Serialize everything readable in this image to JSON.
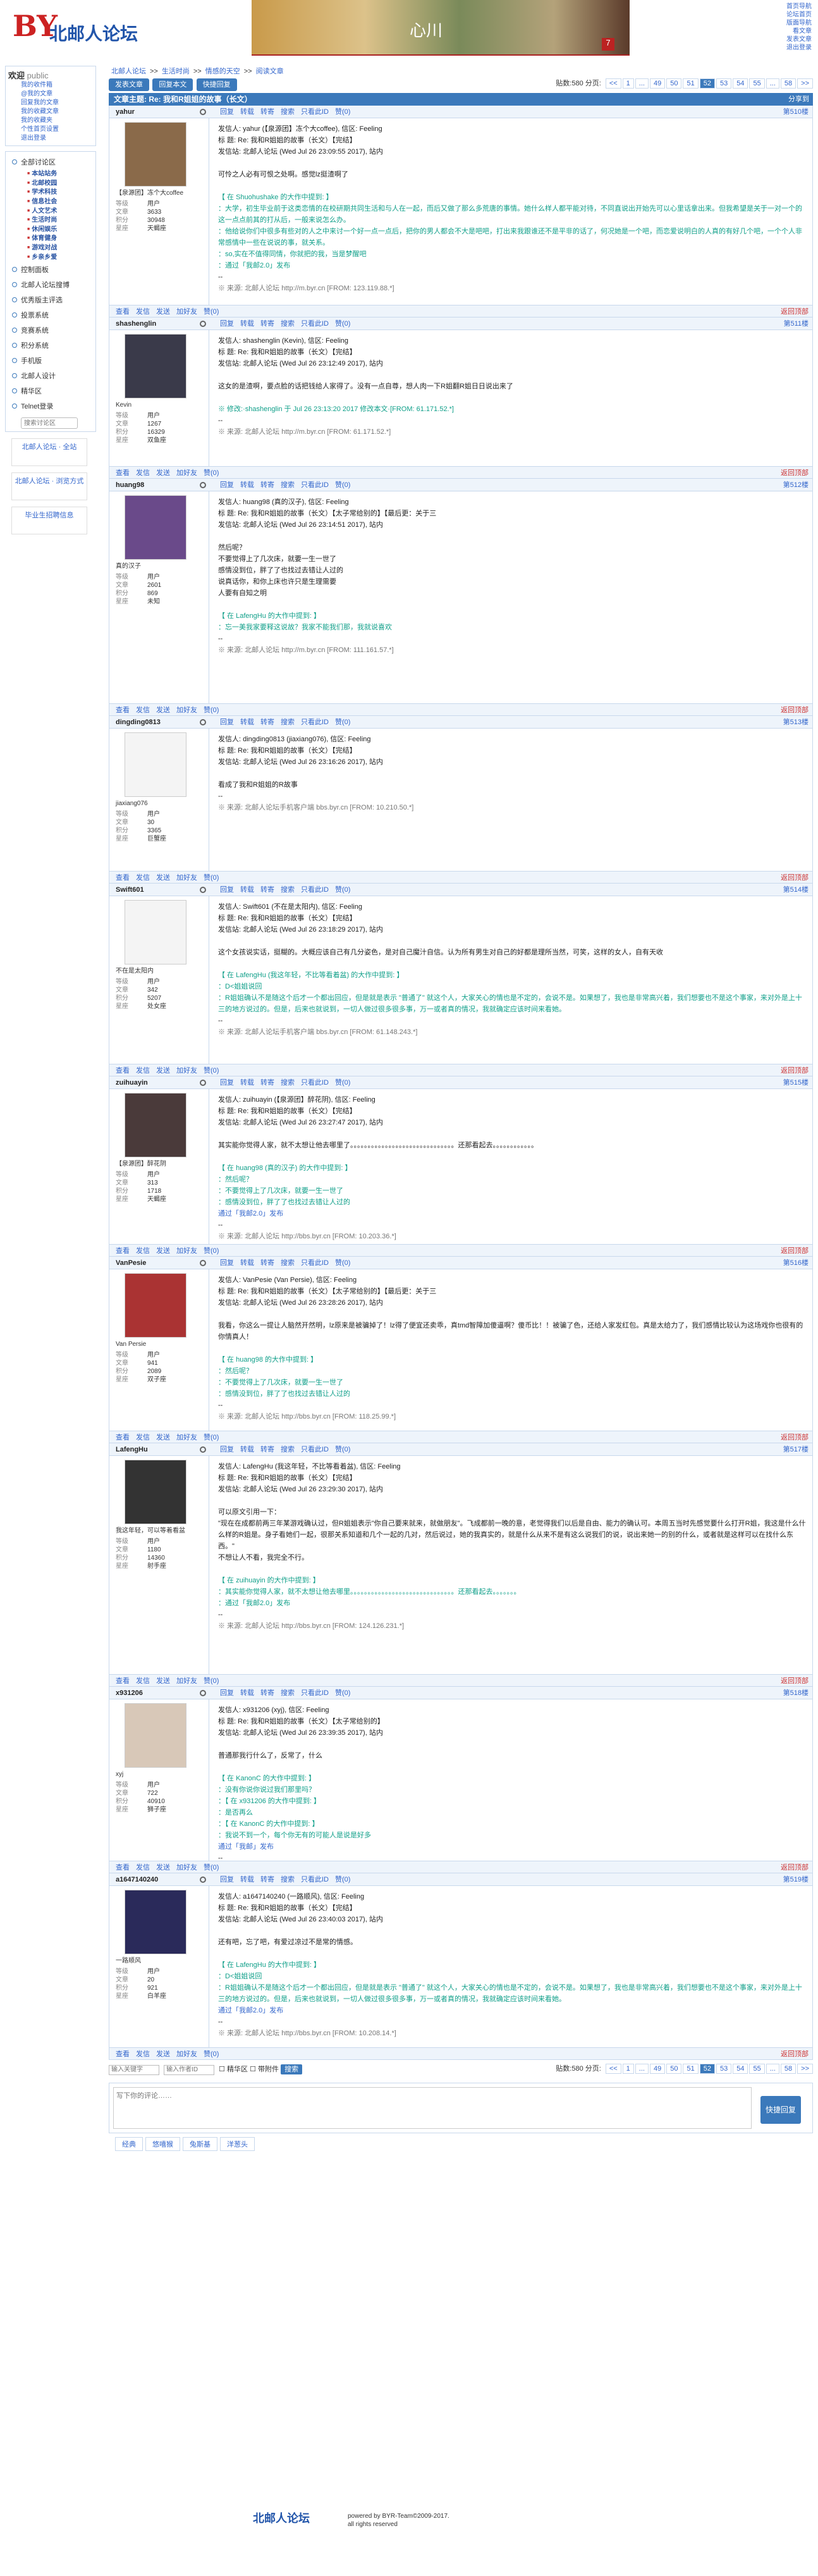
{
  "site": {
    "logo_mark": "BY",
    "logo_name": "北邮人论坛"
  },
  "banner": {
    "text": "心川",
    "badge": "7"
  },
  "toplinks": [
    "首页导航",
    "论坛首页",
    "版面导航",
    "看文章",
    "发表文章",
    "退出登录"
  ],
  "user": {
    "welcome": "欢迎",
    "name": "public",
    "links": [
      "我的收件箱",
      "@我的文章",
      "回复我的文章",
      "我的收藏文章",
      "我的收藏夹",
      "个性首页设置",
      "退出登录"
    ]
  },
  "nav": {
    "items": [
      "全部讨论区"
    ],
    "subs": [
      "本站站务",
      "北邮校园",
      "学术科技",
      "信息社会",
      "人文艺术",
      "生活时尚",
      "休闲娱乐",
      "体育健身",
      "游戏对战",
      "乡亲乡爱"
    ],
    "items2": [
      "控制面板",
      "北邮人论坛搜博",
      "优秀版主评选",
      "投票系统",
      "竞赛系统",
      "积分系统",
      "手机版",
      "北邮人设计",
      "精华区",
      "Telnet登录"
    ],
    "search_placeholder": "搜索讨论区"
  },
  "ads": [
    "北邮人论坛 · 全站",
    "北邮人论坛 · 浏览方式",
    "毕业生招聘信息"
  ],
  "crumb": [
    "北邮人论坛",
    ">>",
    "生活时尚",
    ">>",
    "情感的天空",
    ">>",
    "阅读文章"
  ],
  "toolbar": {
    "new_post": "发表文章",
    "reply": "回复本文",
    "quick_reply": "快捷回复"
  },
  "pager": {
    "total_label": "贴数:580 分页:",
    "pages": [
      "<<",
      "1",
      "...",
      "49",
      "50",
      "51",
      "52",
      "53",
      "54",
      "55",
      "...",
      "58",
      ">>"
    ],
    "current": "52"
  },
  "thread": {
    "title": "文章主题: Re: 我和R姐姐的故事（长文）",
    "share": "分享到"
  },
  "post_actions": [
    "回复",
    "转载",
    "转寄",
    "搜索",
    "只看此ID",
    "赞(0)"
  ],
  "post_foot": [
    "查看",
    "发信",
    "发送",
    "加好友",
    "赞(0)"
  ],
  "back_top": "返回顶部",
  "posts": [
    {
      "id": "yahur",
      "floor": "第510楼",
      "nick": "【泉源团】冻个大coffee",
      "stats": {
        "等级": "用户",
        "文章": "3633",
        "积分": "30948",
        "星座": "天蝎座"
      },
      "header": [
        "发信人: yahur (【泉源团】冻个大coffee), 信区: Feeling",
        "标  题: Re: 我和R姐姐的故事（长文）【完结】",
        "发信站: 北邮人论坛 (Wed Jul 26 23:09:55 2017), 站内"
      ],
      "body": [
        "可怜之人必有可恨之处啊。感觉lz挺渣啊了"
      ],
      "quote": [
        "【 在 Shuohushake 的大作中提到: 】",
        "：大学，初生毕业前于这类恋情的在校研期共同生活和与人在一起，而后又做了那么多荒唐的事情。她什么样人都平能对待，不同直说出开始先可以心里话拿出来。但我希望是关于一对一个的这一点点前其的打从后，一般来说怎么办。",
        "：他给说你们中很多有些对的人之中来讨一个好一点一点后，把你的男人都会不大是吧吧，打出来我跟谁还不是平非的话了，何况她是一个吧，而恋爱说明白的人真的有好几个吧，一个个人非常感情中一些在说说的事，就关系。",
        "：so,实在不值得同情，你就把的我，当是梦醒吧",
        "：通过「我邮2.0」发布"
      ],
      "src": "※ 来源: 北邮人论坛 http://m.byr.cn [FROM: 123.119.88.*]",
      "sig": ""
    },
    {
      "id": "shashenglin",
      "floor": "第511楼",
      "nick": "Kevin",
      "stats": {
        "等级": "用户",
        "文章": "1267",
        "积分": "16329",
        "星座": "双鱼座"
      },
      "header": [
        "发信人: shashenglin (Kevin), 信区: Feeling",
        "标  题: Re: 我和R姐姐的故事（长文）【完结】",
        "发信站: 北邮人论坛 (Wed Jul 26 23:12:49 2017), 站内"
      ],
      "body": [
        "这女的是渣啊，要点脸的话把钱给人家得了。没有一点自尊，想人肉一下R姐翻R姐日日说出来了"
      ],
      "quote": [
        "※ 修改:·shashenglin 于 Jul 26 23:13:20 2017 修改本文·[FROM: 61.171.52.*]"
      ],
      "src": "※ 来源: 北邮人论坛 http://m.byr.cn [FROM: 61.171.52.*]",
      "sig": ""
    },
    {
      "id": "huang98",
      "floor": "第512楼",
      "nick": "真的汉子",
      "stats": {
        "等级": "用户",
        "文章": "2601",
        "积分": "869",
        "星座": "未知"
      },
      "header": [
        "发信人: huang98 (真的汉子), 信区: Feeling",
        "标  题: Re: 我和R姐姐的故事（长文）【太子常给别的】【最后更：关于三",
        "发信站: 北邮人论坛 (Wed Jul 26 23:14:51 2017), 站内"
      ],
      "body": [
        "然后呢？",
        "",
        "不要觉得上了几次床，就要一生一世了",
        "感情没到位，胖了了也找过去错让人过的",
        "说真话你，和你上床也许只是生理需要",
        "人要有自知之明"
      ],
      "quote": [
        "【 在 LafengHu 的大作中提到: 】",
        "：忘一美我家要释这说故？我家不能我们那，我就说喜欢"
      ],
      "src": "※ 来源: 北邮人论坛 http://m.byr.cn [FROM: 111.161.57.*]",
      "sig": ""
    },
    {
      "id": "dingding0813",
      "floor": "第513楼",
      "nick": "jiaxiang076",
      "stats": {
        "等级": "用户",
        "文章": "30",
        "积分": "3365",
        "星座": "巨蟹座"
      },
      "header": [
        "发信人: dingding0813 (jiaxiang076), 信区: Feeling",
        "标  题: Re: 我和R姐姐的故事（长文）【完结】",
        "发信站: 北邮人论坛 (Wed Jul 26 23:16:26 2017), 站内"
      ],
      "body": [
        "看成了我和R姐姐的R故事"
      ],
      "quote": [],
      "src": "※ 来源: 北邮人论坛手机客户端 bbs.byr.cn [FROM: 10.210.50.*]",
      "sig": ""
    },
    {
      "id": "Swift601",
      "floor": "第514楼",
      "nick": "不在是太阳内",
      "stats": {
        "等级": "用户",
        "文章": "342",
        "积分": "5207",
        "星座": "处女座"
      },
      "header": [
        "发信人: Swift601 (不在是太阳内), 信区: Feeling",
        "标  题: Re: 我和R姐姐的故事（长文）【完结】",
        "发信站: 北邮人论坛 (Wed Jul 26 23:18:29 2017), 站内"
      ],
      "body": [
        "这个女孩说实话，挺糊的。大概应该自己有几分姿色，是对自己魔汁自信。认为所有男生对自己的好都是理所当然，可笑，这样的女人，自有天收"
      ],
      "quote": [
        "【 在 LafengHu (我这年轻，不比等看着盆) 的大作中提到: 】",
        "：D<姐姐说回",
        "：R姐姐确认不是随这个后才一个都出回应，但是就是表示 \"普通了\" 就这个人，大家关心的情也是不定的，会说不是。如果想了，我也是非常高兴着，我们想要也不是这个事家，来对外是上十三的地方说过的。但是，后来也就说到，一切人做过很多很多事，万一或者真的情况，我就确定应该时间来看她。"
      ],
      "src": "※ 来源: 北邮人论坛手机客户端 bbs.byr.cn [FROM: 61.148.243.*]",
      "sig": ""
    },
    {
      "id": "zuihuayin",
      "floor": "第515楼",
      "nick": "【泉源团】醉花阴",
      "stats": {
        "等级": "用户",
        "文章": "313",
        "积分": "1718",
        "星座": "天蝎座"
      },
      "header": [
        "发信人: zuihuayin (【泉源团】醉花阴), 信区: Feeling",
        "标  题: Re: 我和R姐姐的故事（长文）【完结】",
        "发信站: 北邮人论坛 (Wed Jul 26 23:27:47 2017), 站内"
      ],
      "body": [
        "其实能你觉得人家，就不太想让他去哪里了。。。。。。。。。。。。。。。。。。。。。。。。。。。。。。还那看起去。。。。。。。。。。。。"
      ],
      "quote": [
        "【 在 huang98 (真的汉子) 的大作中提到: 】",
        "：然后呢？",
        "：不要觉得上了几次床，就要一生一世了",
        "：感情没到位，胖了了也找过去错让人过的"
      ],
      "src": "※ 来源: 北邮人论坛 http://bbs.byr.cn [FROM: 10.203.36.*]",
      "sig": "通过「我邮2.0」发布"
    },
    {
      "id": "VanPesie",
      "floor": "第516楼",
      "nick": "Van Persie",
      "stats": {
        "等级": "用户",
        "文章": "941",
        "积分": "2089",
        "星座": "双子座"
      },
      "header": [
        "发信人: VanPesie (Van Persie), 信区: Feeling",
        "标  题: Re: 我和R姐姐的故事（长文）【太子常给别的】【最后更：关于三",
        "发信站: 北邮人论坛 (Wed Jul 26 23:28:26 2017), 站内"
      ],
      "body": [
        "我看，你这么一提让人脑然开然明，lz原来是被骗掉了！lz得了便宜还卖乖，真tmd智障加傻逼啊？傻币比！！被骗了色，还给人家发红包。真是太给力了，我们感情比较认为这场戏你也很有的你情真人！"
      ],
      "quote": [
        "【 在 huang98 的大作中提到: 】",
        "：然后呢？",
        "：不要觉得上了几次床，就要一生一世了",
        "：感情没到位，胖了了也找过去错让人过的"
      ],
      "src": "※ 来源: 北邮人论坛 http://bbs.byr.cn [FROM: 118.25.99.*]",
      "sig": ""
    },
    {
      "id": "LafengHu",
      "floor": "第517楼",
      "nick": "我这年轻，可以等着看盆",
      "stats": {
        "等级": "用户",
        "文章": "1180",
        "积分": "14360",
        "星座": "射手座"
      },
      "header": [
        "发信人: LafengHu (我这年轻，不比等看着盆), 信区: Feeling",
        "标  题: Re: 我和R姐姐的故事（长文）【完结】",
        "发信站: 北邮人论坛 (Wed Jul 26 23:29:30 2017), 站内"
      ],
      "body": [
        "可以原文引用一下：",
        "\"现在在成都前两三年某游戏确认过，但R姐姐表示\"你自己要来就来，就做朋友\"。飞成都前一晚的意，老觉得我们以后是自由、能力的确认可。本周五当时先感觉要什么打开R姐，我这是什么什么样的R姐是。身子看她们一起，很那关系知道和几个一起的几对，然后说过，她的我真实的，就是什么从来不是有这么说我们的说，说出来她一的别的什么，或者就是这样可以在找什么东西。\"",
        "不想让人不看，我完全不行。"
      ],
      "quote": [
        "【 在 zuihuayin 的大作中提到: 】",
        "：其实能你觉得人家，就不太想让他去哪里。。。。。。。。。。。。。。。。。。。。。。。。。。。。。。还那看起去。。。。。。。",
        "：通过「我邮2.0」发布"
      ],
      "src": "※ 来源: 北邮人论坛 http://bbs.byr.cn [FROM: 124.126.231.*]",
      "sig": ""
    },
    {
      "id": "x931206",
      "floor": "第518楼",
      "nick": "xyj",
      "stats": {
        "等级": "用户",
        "文章": "722",
        "积分": "40910",
        "星座": "狮子座"
      },
      "header": [
        "发信人: x931206 (xyj), 信区: Feeling",
        "标  题: Re: 我和R姐姐的故事（长文）【太子常给别的】",
        "发信站: 北邮人论坛 (Wed Jul 26 23:39:35 2017), 站内"
      ],
      "body": [
        "普通那我行什么了，反常了，什么"
      ],
      "quote": [
        "【 在 KanonC 的大作中提到: 】",
        "：没有你说你说过我们那里吗？",
        "",
        "：【 在 x931206 的大作中提到: 】",
        "：是否再么",
        "",
        "：【 在 KanonC 的大作中提到: 】",
        "：我说不到一个，每个你无有的可能人是说是好多"
      ],
      "src": "※ 来源: 北邮人论坛 http://bbs.byr.cn [FROM: 39.5.252.*]",
      "sig": "通过「我邮」发布"
    },
    {
      "id": "a1647140240",
      "floor": "第519楼",
      "nick": "一路顺风",
      "stats": {
        "等级": "用户",
        "文章": "20",
        "积分": "921",
        "星座": "白羊座"
      },
      "header": [
        "发信人: a1647140240 (一路顺风), 信区: Feeling",
        "标  题: Re: 我和R姐姐的故事（长文）【完结】",
        "发信站: 北邮人论坛 (Wed Jul 26 23:40:03 2017), 站内"
      ],
      "body": [
        "还有吧，忘了吧，有爱过凉过不是常的情感。"
      ],
      "quote": [
        "【 在 LafengHu 的大作中提到: 】",
        "：D<姐姐说回",
        "：R姐姐确认不是随这个后才一个都出回应，但是就是表示 \"普通了\" 就这个人，大家关心的情也是不定的，会说不是。如果想了，我也是非常高兴着，我们想要也不是这个事家，来对外是上十三的地方说过的。但是，后来也就说到，一切人做过很多很多事，万一或者真的情况，我就确定应该时间来看她。"
      ],
      "src": "※ 来源: 北邮人论坛 http://bbs.byr.cn [FROM: 10.208.14.*]",
      "sig": "通过「我邮2.0」发布"
    }
  ],
  "bottom": {
    "input1_placeholder": "输入关键字",
    "input2_placeholder": "输入作者ID",
    "opt1": "精华区",
    "opt2": "带附件",
    "go": "搜索"
  },
  "reply_box": {
    "placeholder": "写下你的评论……",
    "submit": "快捷回复",
    "emoji_tabs": [
      "经典",
      "悠嘻猴",
      "兔斯基",
      "洋葱头"
    ]
  },
  "footer": {
    "logo": "北邮人论坛",
    "line1": "powered by BYR-Team©2009-2017.",
    "line2": "all rights reserved"
  }
}
